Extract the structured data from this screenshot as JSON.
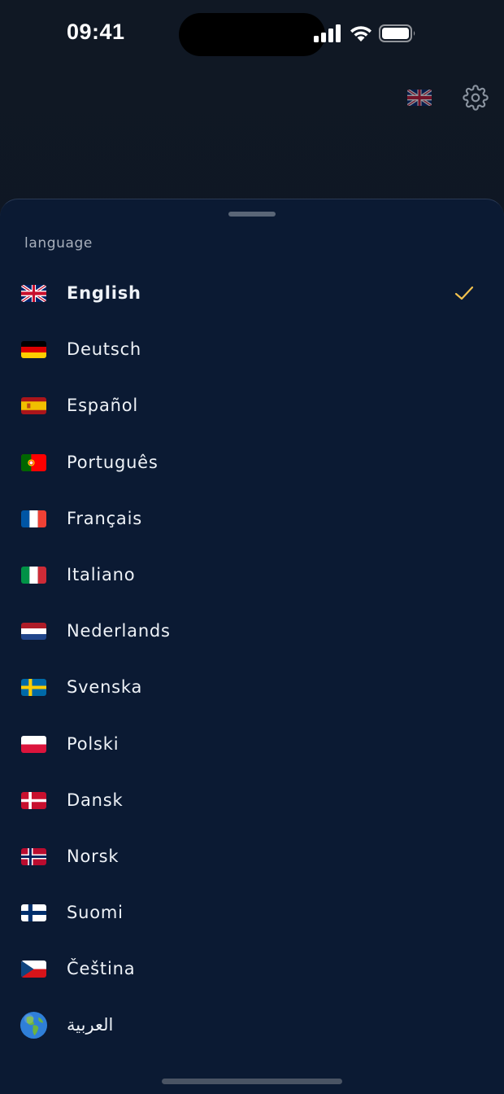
{
  "status_bar": {
    "time": "09:41",
    "icons": [
      "cellular-signal-icon",
      "wifi-icon",
      "battery-icon"
    ]
  },
  "header": {
    "current_flag": "uk-flag-icon",
    "settings_icon": "gear-icon"
  },
  "sheet": {
    "title": "language",
    "selected": "English",
    "accent_color": "#f2c14e",
    "languages": [
      {
        "label": "English",
        "flag": "uk-flag-icon",
        "selected": true
      },
      {
        "label": "Deutsch",
        "flag": "germany-flag-icon",
        "selected": false
      },
      {
        "label": "Español",
        "flag": "spain-flag-icon",
        "selected": false
      },
      {
        "label": "Português",
        "flag": "portugal-flag-icon",
        "selected": false
      },
      {
        "label": "Français",
        "flag": "france-flag-icon",
        "selected": false
      },
      {
        "label": "Italiano",
        "flag": "italy-flag-icon",
        "selected": false
      },
      {
        "label": "Nederlands",
        "flag": "netherlands-flag-icon",
        "selected": false
      },
      {
        "label": "Svenska",
        "flag": "sweden-flag-icon",
        "selected": false
      },
      {
        "label": "Polski",
        "flag": "poland-flag-icon",
        "selected": false
      },
      {
        "label": "Dansk",
        "flag": "denmark-flag-icon",
        "selected": false
      },
      {
        "label": "Norsk",
        "flag": "norway-flag-icon",
        "selected": false
      },
      {
        "label": "Suomi",
        "flag": "finland-flag-icon",
        "selected": false
      },
      {
        "label": "Čeština",
        "flag": "czech-flag-icon",
        "selected": false
      },
      {
        "label": "العربية",
        "flag": "globe-icon",
        "selected": false
      }
    ]
  }
}
